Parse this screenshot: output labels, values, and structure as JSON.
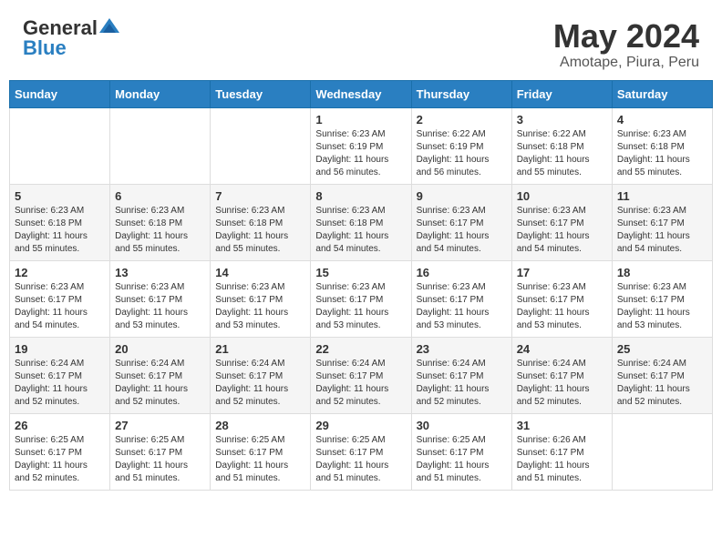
{
  "header": {
    "logo_general": "General",
    "logo_blue": "Blue",
    "title": "May 2024",
    "subtitle": "Amotape, Piura, Peru"
  },
  "days_of_week": [
    "Sunday",
    "Monday",
    "Tuesday",
    "Wednesday",
    "Thursday",
    "Friday",
    "Saturday"
  ],
  "weeks": [
    [
      {
        "day": "",
        "info": ""
      },
      {
        "day": "",
        "info": ""
      },
      {
        "day": "",
        "info": ""
      },
      {
        "day": "1",
        "info": "Sunrise: 6:23 AM\nSunset: 6:19 PM\nDaylight: 11 hours and 56 minutes."
      },
      {
        "day": "2",
        "info": "Sunrise: 6:22 AM\nSunset: 6:19 PM\nDaylight: 11 hours and 56 minutes."
      },
      {
        "day": "3",
        "info": "Sunrise: 6:22 AM\nSunset: 6:18 PM\nDaylight: 11 hours and 55 minutes."
      },
      {
        "day": "4",
        "info": "Sunrise: 6:23 AM\nSunset: 6:18 PM\nDaylight: 11 hours and 55 minutes."
      }
    ],
    [
      {
        "day": "5",
        "info": "Sunrise: 6:23 AM\nSunset: 6:18 PM\nDaylight: 11 hours and 55 minutes."
      },
      {
        "day": "6",
        "info": "Sunrise: 6:23 AM\nSunset: 6:18 PM\nDaylight: 11 hours and 55 minutes."
      },
      {
        "day": "7",
        "info": "Sunrise: 6:23 AM\nSunset: 6:18 PM\nDaylight: 11 hours and 55 minutes."
      },
      {
        "day": "8",
        "info": "Sunrise: 6:23 AM\nSunset: 6:18 PM\nDaylight: 11 hours and 54 minutes."
      },
      {
        "day": "9",
        "info": "Sunrise: 6:23 AM\nSunset: 6:17 PM\nDaylight: 11 hours and 54 minutes."
      },
      {
        "day": "10",
        "info": "Sunrise: 6:23 AM\nSunset: 6:17 PM\nDaylight: 11 hours and 54 minutes."
      },
      {
        "day": "11",
        "info": "Sunrise: 6:23 AM\nSunset: 6:17 PM\nDaylight: 11 hours and 54 minutes."
      }
    ],
    [
      {
        "day": "12",
        "info": "Sunrise: 6:23 AM\nSunset: 6:17 PM\nDaylight: 11 hours and 54 minutes."
      },
      {
        "day": "13",
        "info": "Sunrise: 6:23 AM\nSunset: 6:17 PM\nDaylight: 11 hours and 53 minutes."
      },
      {
        "day": "14",
        "info": "Sunrise: 6:23 AM\nSunset: 6:17 PM\nDaylight: 11 hours and 53 minutes."
      },
      {
        "day": "15",
        "info": "Sunrise: 6:23 AM\nSunset: 6:17 PM\nDaylight: 11 hours and 53 minutes."
      },
      {
        "day": "16",
        "info": "Sunrise: 6:23 AM\nSunset: 6:17 PM\nDaylight: 11 hours and 53 minutes."
      },
      {
        "day": "17",
        "info": "Sunrise: 6:23 AM\nSunset: 6:17 PM\nDaylight: 11 hours and 53 minutes."
      },
      {
        "day": "18",
        "info": "Sunrise: 6:23 AM\nSunset: 6:17 PM\nDaylight: 11 hours and 53 minutes."
      }
    ],
    [
      {
        "day": "19",
        "info": "Sunrise: 6:24 AM\nSunset: 6:17 PM\nDaylight: 11 hours and 52 minutes."
      },
      {
        "day": "20",
        "info": "Sunrise: 6:24 AM\nSunset: 6:17 PM\nDaylight: 11 hours and 52 minutes."
      },
      {
        "day": "21",
        "info": "Sunrise: 6:24 AM\nSunset: 6:17 PM\nDaylight: 11 hours and 52 minutes."
      },
      {
        "day": "22",
        "info": "Sunrise: 6:24 AM\nSunset: 6:17 PM\nDaylight: 11 hours and 52 minutes."
      },
      {
        "day": "23",
        "info": "Sunrise: 6:24 AM\nSunset: 6:17 PM\nDaylight: 11 hours and 52 minutes."
      },
      {
        "day": "24",
        "info": "Sunrise: 6:24 AM\nSunset: 6:17 PM\nDaylight: 11 hours and 52 minutes."
      },
      {
        "day": "25",
        "info": "Sunrise: 6:24 AM\nSunset: 6:17 PM\nDaylight: 11 hours and 52 minutes."
      }
    ],
    [
      {
        "day": "26",
        "info": "Sunrise: 6:25 AM\nSunset: 6:17 PM\nDaylight: 11 hours and 52 minutes."
      },
      {
        "day": "27",
        "info": "Sunrise: 6:25 AM\nSunset: 6:17 PM\nDaylight: 11 hours and 51 minutes."
      },
      {
        "day": "28",
        "info": "Sunrise: 6:25 AM\nSunset: 6:17 PM\nDaylight: 11 hours and 51 minutes."
      },
      {
        "day": "29",
        "info": "Sunrise: 6:25 AM\nSunset: 6:17 PM\nDaylight: 11 hours and 51 minutes."
      },
      {
        "day": "30",
        "info": "Sunrise: 6:25 AM\nSunset: 6:17 PM\nDaylight: 11 hours and 51 minutes."
      },
      {
        "day": "31",
        "info": "Sunrise: 6:26 AM\nSunset: 6:17 PM\nDaylight: 11 hours and 51 minutes."
      },
      {
        "day": "",
        "info": ""
      }
    ]
  ]
}
